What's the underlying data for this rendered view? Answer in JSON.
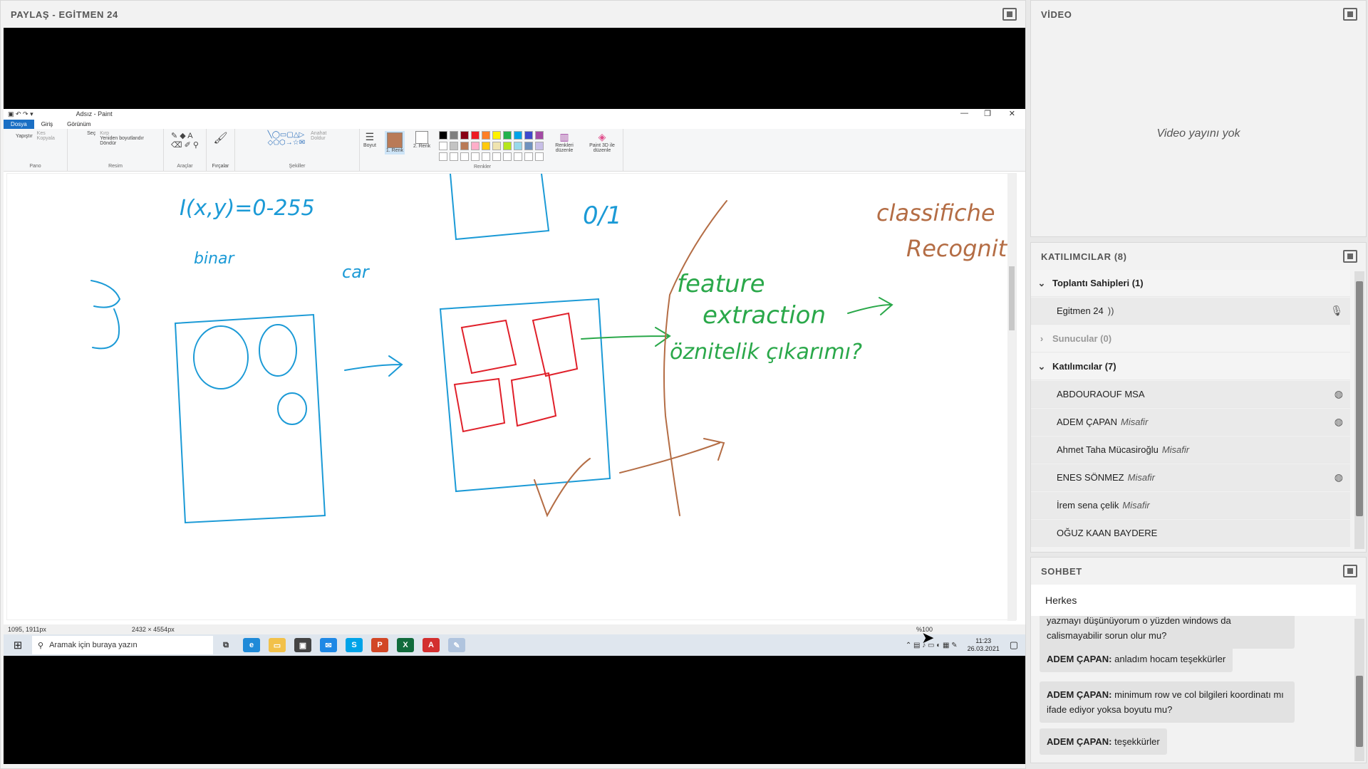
{
  "share": {
    "title": "PAYLAŞ  - EGİTMEN 24"
  },
  "paint": {
    "title": "Adsız - Paint",
    "tabs": [
      "Dosya",
      "Giriş",
      "Görünüm"
    ],
    "groups": {
      "pano": "Pano",
      "resim": "Resim",
      "araclar": "Araçlar",
      "sekiller": "Şekiller",
      "renkler": "Renkler"
    },
    "tools": {
      "paste": "Yapıştır",
      "cut": "Kes",
      "copy": "Kopyala",
      "select": "Seç",
      "crop": "Kırp",
      "resize": "Yeniden boyutlandır",
      "rotate": "Döndür",
      "brushes": "Fırçalar",
      "outline": "Anahat",
      "fill": "Doldur",
      "size": "Boyut",
      "color1": "1. Renk",
      "color2": "2. Renk",
      "edit_colors": "Renkleri düzenle",
      "paint3d": "Paint 3D ile düzenle"
    },
    "palette": [
      "#000000",
      "#7f7f7f",
      "#880015",
      "#ed1c24",
      "#ff7f27",
      "#fff200",
      "#22b14c",
      "#00a2e8",
      "#3f48cc",
      "#a349a4",
      "#ffffff",
      "#c3c3c3",
      "#b97a57",
      "#ffaec9",
      "#ffc90e",
      "#efe4b0",
      "#b5e61d",
      "#99d9ea",
      "#7092be",
      "#c8bfe7"
    ],
    "status": {
      "cursor": "1095, 1911px",
      "size": "2432 × 4554px",
      "zoom": "%100"
    },
    "canvas_text": {
      "formula": "I(x,y)=0-255",
      "binary": "binar",
      "step": "3)",
      "car": "car",
      "feature1": "feature",
      "feature2": "extraction",
      "ozn": "öznitelik çıkarımı?",
      "class1": "classifiche",
      "class2": "Recognit",
      "pct": "0/1"
    }
  },
  "taskbar": {
    "search_placeholder": "Aramak için buraya yazın",
    "time": "11:23",
    "date": "26.03.2021"
  },
  "video": {
    "title": "VİDEO",
    "empty": "Video yayını yok"
  },
  "attendees": {
    "title": "KATILIMCILAR  (8)",
    "hosts_label": "Toplantı Sahipleri (1)",
    "host": "Egitmen 24",
    "presenters_label": "Sunucular (0)",
    "participants_label": "Katılımcılar (7)",
    "guest_tag": "Misafir",
    "people": [
      {
        "name": "ABDOURAOUF MSA",
        "guest": false
      },
      {
        "name": "ADEM ÇAPAN",
        "guest": true
      },
      {
        "name": "Ahmet Taha Mücasiroğlu",
        "guest": true
      },
      {
        "name": "ENES SÖNMEZ",
        "guest": true
      },
      {
        "name": "İrem sena çelik",
        "guest": true
      },
      {
        "name": "OĞUZ KAAN BAYDERE",
        "guest": false
      }
    ]
  },
  "chat": {
    "title": "SOHBET",
    "recipient": "Herkes",
    "partial": "yazmayı düşünüyorum o yüzden windows da calismayabilir sorun olur mu?",
    "messages": [
      {
        "author": "ADEM ÇAPAN:",
        "text": "anladım hocam teşekkürler"
      },
      {
        "author": "ADEM ÇAPAN:",
        "text": "minimum row ve col bilgileri koordinatı mı ifade ediyor yoksa boyutu  mu?"
      },
      {
        "author": "ADEM ÇAPAN:",
        "text": "teşekkürler"
      }
    ]
  }
}
